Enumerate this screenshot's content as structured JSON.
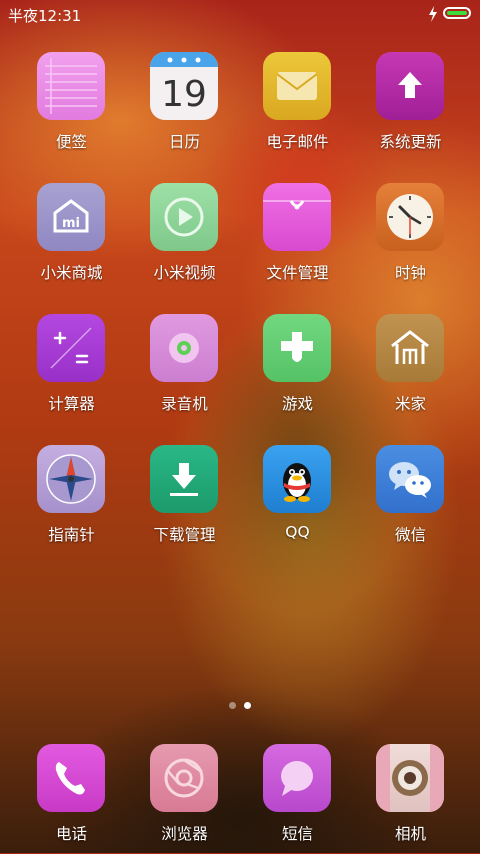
{
  "status_bar": {
    "time": "半夜12:31",
    "icons": [
      "charging-icon",
      "battery-icon"
    ],
    "battery_color": "#3ddc3d"
  },
  "home_apps": [
    {
      "label": "便签",
      "icon": "notes-icon",
      "color": "#e78ae6"
    },
    {
      "label": "日历",
      "icon": "calendar-icon",
      "color": "#f4f0f2",
      "day": "19"
    },
    {
      "label": "电子邮件",
      "icon": "mail-icon",
      "color": "#e2b92b"
    },
    {
      "label": "系统更新",
      "icon": "update-arrow-icon",
      "color": "#b92aa6"
    },
    {
      "label": "小米商城",
      "icon": "mi-store-icon",
      "color": "#9d96c8"
    },
    {
      "label": "小米视频",
      "icon": "play-icon",
      "color": "#8fd59a"
    },
    {
      "label": "文件管理",
      "icon": "folder-icon",
      "color": "#e855d8"
    },
    {
      "label": "时钟",
      "icon": "clock-icon",
      "color": "#d8742a"
    },
    {
      "label": "计算器",
      "icon": "calculator-icon",
      "color": "#a63ad6"
    },
    {
      "label": "录音机",
      "icon": "recorder-icon",
      "color": "#d88ed8"
    },
    {
      "label": "游戏",
      "icon": "gamepad-icon",
      "color": "#63cf73"
    },
    {
      "label": "米家",
      "icon": "mijia-home-icon",
      "color": "#b38742"
    },
    {
      "label": "指南针",
      "icon": "compass-icon",
      "color": "#b8a0d8"
    },
    {
      "label": "下载管理",
      "icon": "download-icon",
      "color": "#22a87a"
    },
    {
      "label": "QQ",
      "icon": "qq-penguin-icon",
      "color": "#2a8ee0"
    },
    {
      "label": "微信",
      "icon": "wechat-icon",
      "color": "#3a7fd8"
    }
  ],
  "page_indicator": {
    "pages": 2,
    "active": 1
  },
  "dock_apps": [
    {
      "label": "电话",
      "icon": "phone-icon",
      "color": "#d64ad2"
    },
    {
      "label": "浏览器",
      "icon": "browser-icon",
      "color": "#e08aa0"
    },
    {
      "label": "短信",
      "icon": "message-icon",
      "color": "#c85ad6"
    },
    {
      "label": "相机",
      "icon": "camera-icon",
      "color": "#e8c8c8"
    }
  ]
}
